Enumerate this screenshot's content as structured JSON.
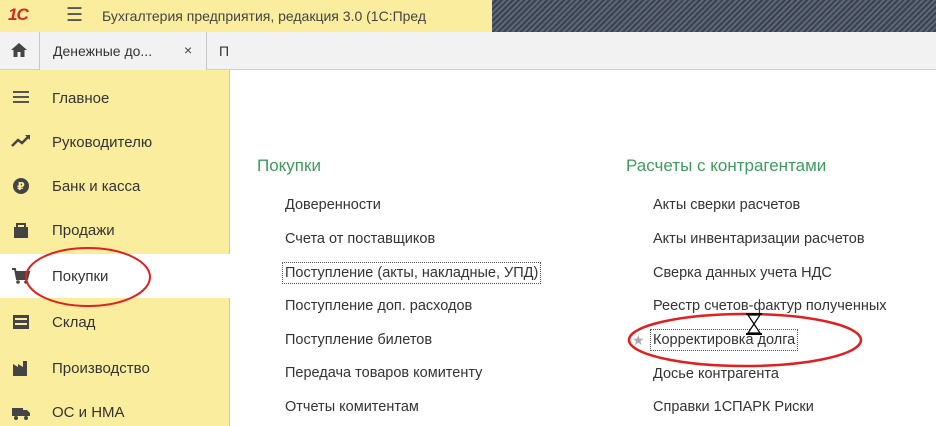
{
  "window": {
    "logo": "1С",
    "title": "Бухгалтерия предприятия, редакция 3.0  (1С:Пред"
  },
  "tabs": {
    "home_icon": "home-icon",
    "doc_tab_label": "Денежные до...",
    "doc_tab_close": "×",
    "partial_tab_label": "П"
  },
  "sidebar": {
    "items": [
      {
        "label": "Главное",
        "icon": "menu-lines-icon"
      },
      {
        "label": "Руководителю",
        "icon": "trend-icon"
      },
      {
        "label": "Банк и касса",
        "icon": "coin-icon"
      },
      {
        "label": "Продажи",
        "icon": "bag-icon"
      },
      {
        "label": "Покупки",
        "icon": "cart-icon",
        "active": true
      },
      {
        "label": "Склад",
        "icon": "warehouse-icon"
      },
      {
        "label": "Производство",
        "icon": "factory-icon"
      },
      {
        "label": "ОС и НМА",
        "icon": "truck-icon"
      }
    ]
  },
  "purchases": {
    "title": "Покупки",
    "links": [
      "Доверенности",
      "Счета от поставщиков",
      "Поступление (акты, накладные, УПД)",
      "Поступление доп. расходов",
      "Поступление билетов",
      "Передача товаров комитенту",
      "Отчеты комитентам"
    ]
  },
  "settlements": {
    "title": "Расчеты с контрагентами",
    "links": [
      "Акты сверки расчетов",
      "Акты инвентаризации расчетов",
      "Сверка данных учета НДС",
      "Реестр счетов-фактур полученных",
      "Корректировка долга",
      "Досье контрагента",
      "Справки 1СПАРК Риски"
    ]
  },
  "colors": {
    "sidebar_bg": "#fbed9e",
    "section_title": "#3f9a5e",
    "annotation": "#e02020"
  }
}
